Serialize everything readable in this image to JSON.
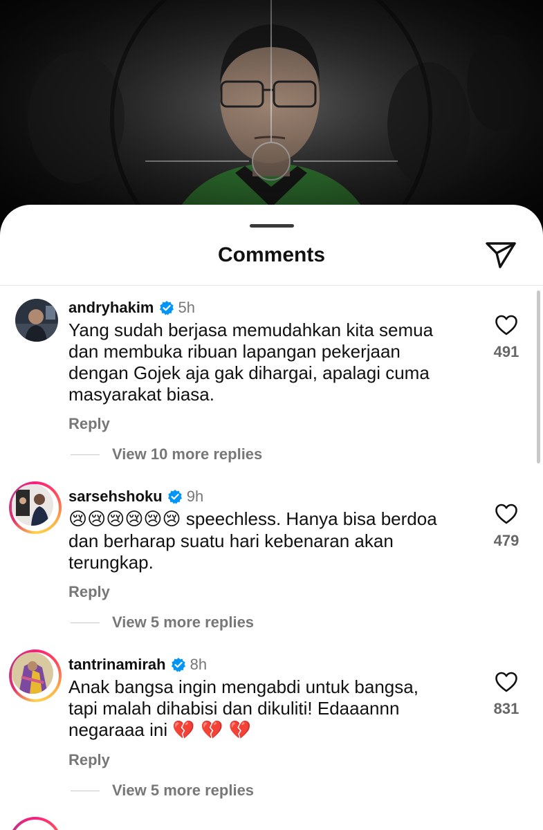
{
  "sheet": {
    "title": "Comments",
    "share_icon": "paper-plane-icon"
  },
  "comments": [
    {
      "username": "andryhakim",
      "verified": true,
      "time": "5h",
      "text": "Yang sudah berjasa memudahkan kita semua dan membuka ribuan lapangan pekerjaan dengan Gojek aja gak dihargai, apalagi cuma masyarakat biasa.",
      "reply_label": "Reply",
      "view_replies": "View 10 more replies",
      "likes": "491"
    },
    {
      "username": "sarsehshoku",
      "verified": true,
      "time": "9h",
      "emojis": "😢😢😢😢😢😢",
      "text": "speechless. Hanya bisa berdoa dan berharap suatu hari kebenaran akan terungkap.",
      "reply_label": "Reply",
      "view_replies": "View 5 more replies",
      "likes": "479"
    },
    {
      "username": "tantrinamirah",
      "verified": true,
      "time": "8h",
      "text": "Anak bangsa ingin mengabdi untuk bangsa, tapi malah dihabisi dan dikuliti! Edaaannn negaraaa ini",
      "emojis_end": "💔 💔 💔",
      "reply_label": "Reply",
      "view_replies": "View 5 more replies",
      "likes": "831"
    }
  ],
  "colors": {
    "verified_blue": "#0095f6",
    "ring_pink": "#e1306c",
    "ring_orange": "#fcaf45"
  }
}
